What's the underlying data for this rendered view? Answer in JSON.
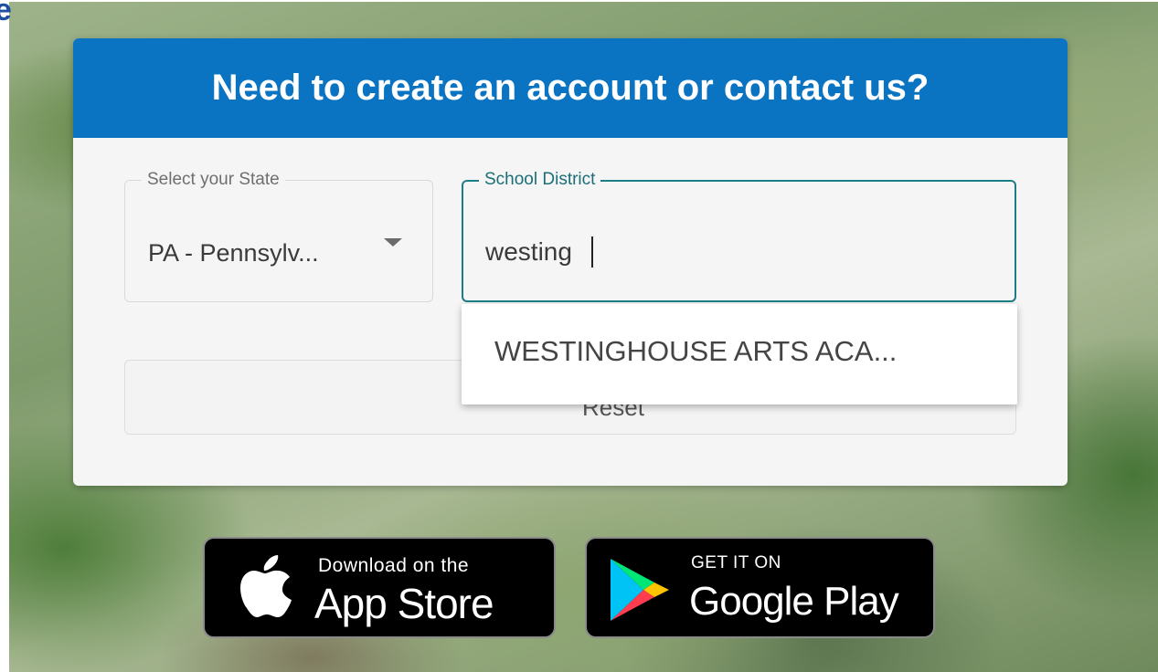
{
  "page": {
    "corner_glyph": "e"
  },
  "card": {
    "title": "Need to create an account or contact us?",
    "state_select": {
      "label": "Select your State",
      "value": "PA - Pennsylv..."
    },
    "district_input": {
      "label": "School District",
      "value": "westing"
    },
    "suggestions": [
      "WESTINGHOUSE ARTS ACA..."
    ],
    "reset_button": {
      "label": "Reset"
    }
  },
  "badges": {
    "app_store": {
      "line1": "Download on the",
      "line2": "App Store",
      "icon": "apple-icon"
    },
    "google_play": {
      "line1": "GET IT ON",
      "line2": "Google Play",
      "icon": "google-play-icon"
    }
  },
  "colors": {
    "header_bg": "#0b74c2",
    "focus_border": "#1b7e86",
    "card_bg": "#f5f5f5"
  }
}
